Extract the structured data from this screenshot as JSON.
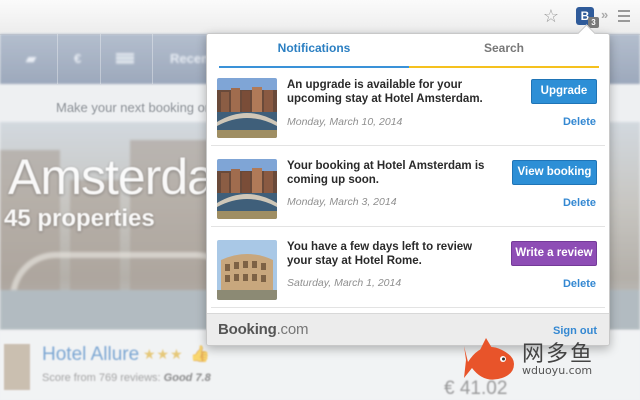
{
  "browser": {
    "ext_label": "B",
    "ext_badge": "3",
    "overflow": "»"
  },
  "site": {
    "nav": {
      "lang_icon": "speech-bubble-icon",
      "currency": "€",
      "flag_icon": "us-flag-icon",
      "recent": "Recen"
    },
    "tagline": "Make your next booking on",
    "hero": {
      "city": "Amsterda",
      "properties": "45 properties"
    },
    "listing": {
      "name": "Hotel Allure",
      "stars": "★★★",
      "score_prefix": "Score from 769 reviews:",
      "score_value": "Good 7.8",
      "price": "€ 41.02"
    }
  },
  "popup": {
    "tabs": [
      {
        "label": "Notifications",
        "active": true
      },
      {
        "label": "Search",
        "active": false
      }
    ],
    "notifications": [
      {
        "message": "An upgrade is available for your upcoming stay at Hotel Amsterdam.",
        "date": "Monday, March 10, 2014",
        "action": "Upgrade",
        "delete": "Delete",
        "image_icon": "amsterdam-canal-photo"
      },
      {
        "message": "Your booking at Hotel Amsterdam is coming up soon.",
        "date": "Monday, March 3, 2014",
        "action": "View booking",
        "delete": "Delete",
        "image_icon": "amsterdam-canal-photo"
      },
      {
        "message": "You have a few days left to review your stay at Hotel Rome.",
        "date": "Saturday, March 1, 2014",
        "action": "Write a review",
        "delete": "Delete",
        "image_icon": "colosseum-photo"
      }
    ],
    "footer": {
      "brand": "Booking",
      "brand_suffix": ".com",
      "signout": "Sign out"
    }
  },
  "watermark": {
    "text": "网多鱼",
    "url": "wduoyu.com"
  },
  "colors": {
    "tab_active": "#2b7fc2",
    "tab_search_underline": "#f5c11e",
    "button_blue": "#2d8fd6",
    "button_purple": "#8e4db5",
    "link": "#3488d2"
  }
}
